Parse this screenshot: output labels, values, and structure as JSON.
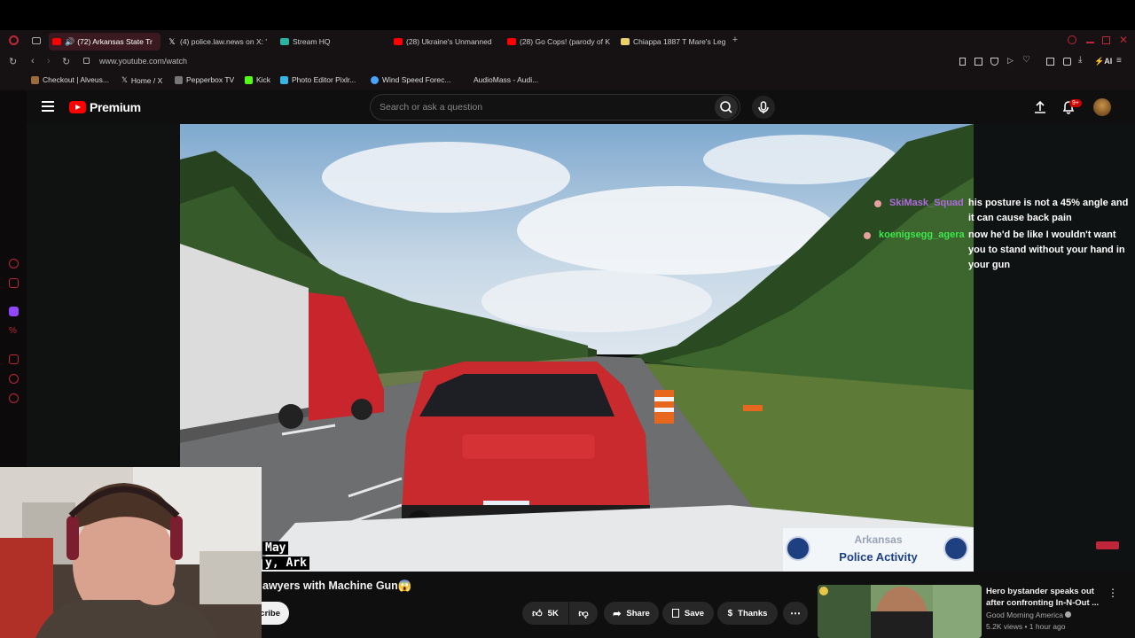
{
  "browser": {
    "tabs": [
      {
        "label": "(72) Arkansas State Tr",
        "icon": "youtube-icon",
        "active": true
      },
      {
        "label": "(4) police.law.news on X: '",
        "icon": "x-icon"
      },
      {
        "label": "Stream HQ",
        "icon": "streamhq-icon"
      },
      {
        "label": "(28) Ukraine's Unmanned ",
        "icon": "youtube-icon"
      },
      {
        "label": "(28) Go Cops! (parody of K",
        "icon": "youtube-icon"
      },
      {
        "label": "Chiappa 1887 T Mare's Leg",
        "icon": "chiappa-icon"
      }
    ],
    "url": "www.youtube.com/watch",
    "bookmarks": [
      "Checkout | Alveus...",
      "Home / X",
      "Pepperbox TV",
      "Kick",
      "Photo Editor Pixlr...",
      "Wind Speed Forec...",
      "AudioMass - Audi..."
    ],
    "ai_label": "AI"
  },
  "youtube": {
    "logo_text": "Premium",
    "search_placeholder": "Search or ask a question",
    "notification_count": "9+"
  },
  "video": {
    "overlay_line1": "May",
    "overlay_line2": "y, Ark",
    "badge_title": "Arkansas",
    "badge_subtitle": "Police Activity",
    "title": "awyers with Machine Gun😱",
    "subscribe_partial": "cribe",
    "likes": "5K",
    "share_label": "Share",
    "save_label": "Save",
    "thanks_label": "Thanks"
  },
  "chat": [
    {
      "user": "SkiMask_Squad",
      "message": "his posture is not a 45% angle and it can cause back pain",
      "color": "#b06adf"
    },
    {
      "user": "koenigsegg_agera",
      "message": "now he'd be like I wouldn't want you to stand without your hand in your gun",
      "color": "#3ce84c"
    }
  ],
  "recommendation": {
    "title": "Hero bystander speaks out after confronting In-N-Out ...",
    "channel": "Good Morning America",
    "meta": "5.2K views • 1 hour ago"
  },
  "colors": {
    "accent": "#ff0000",
    "opera_red": "#c0263a",
    "chat_user1": "#b06adf",
    "chat_user2": "#3ce84c"
  }
}
